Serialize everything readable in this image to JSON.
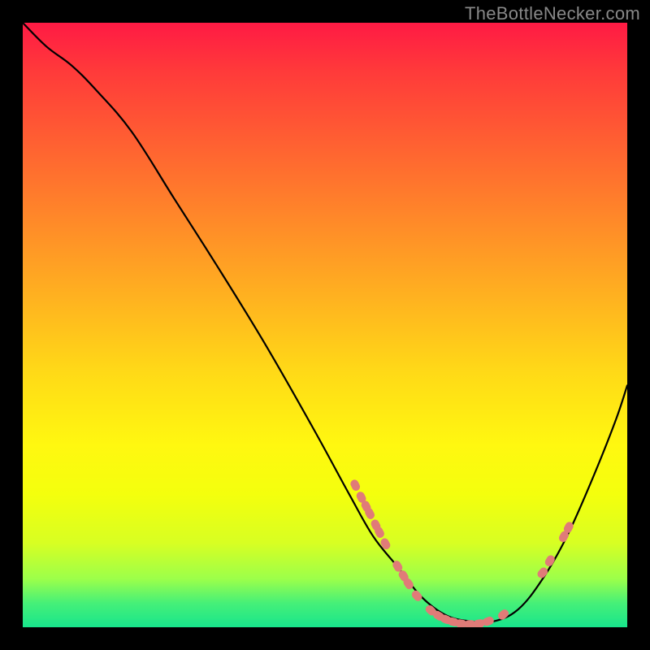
{
  "watermark": "TheBottleNecker.com",
  "chart_data": {
    "type": "line",
    "title": "",
    "xlabel": "",
    "ylabel": "",
    "xlim": [
      0,
      100
    ],
    "ylim": [
      0,
      100
    ],
    "series": [
      {
        "name": "curve",
        "x": [
          0,
          4,
          8,
          12,
          18,
          25,
          32,
          40,
          48,
          54,
          58,
          62,
          66,
          70,
          74,
          78,
          82,
          86,
          90,
          94,
          98,
          100
        ],
        "y": [
          100,
          96,
          93,
          89,
          82,
          71,
          60,
          47,
          33,
          22,
          15,
          10,
          5,
          2,
          1,
          1,
          3,
          8,
          15,
          24,
          34,
          40
        ]
      }
    ],
    "markers": [
      {
        "x": 55.0,
        "y": 23.5
      },
      {
        "x": 56.0,
        "y": 21.5
      },
      {
        "x": 56.8,
        "y": 20.0
      },
      {
        "x": 57.4,
        "y": 18.8
      },
      {
        "x": 58.4,
        "y": 16.9
      },
      {
        "x": 59.0,
        "y": 15.7
      },
      {
        "x": 60.0,
        "y": 13.8
      },
      {
        "x": 62.0,
        "y": 10.1
      },
      {
        "x": 63.0,
        "y": 8.5
      },
      {
        "x": 63.8,
        "y": 7.2
      },
      {
        "x": 65.2,
        "y": 5.2
      },
      {
        "x": 67.5,
        "y": 2.8
      },
      {
        "x": 68.8,
        "y": 1.9
      },
      {
        "x": 70.0,
        "y": 1.3
      },
      {
        "x": 71.2,
        "y": 0.9
      },
      {
        "x": 72.5,
        "y": 0.6
      },
      {
        "x": 74.0,
        "y": 0.5
      },
      {
        "x": 75.5,
        "y": 0.6
      },
      {
        "x": 77.0,
        "y": 1.0
      },
      {
        "x": 79.5,
        "y": 2.1
      },
      {
        "x": 86.0,
        "y": 9.0
      },
      {
        "x": 87.2,
        "y": 11.0
      },
      {
        "x": 89.5,
        "y": 15.0
      },
      {
        "x": 90.3,
        "y": 16.5
      }
    ]
  }
}
